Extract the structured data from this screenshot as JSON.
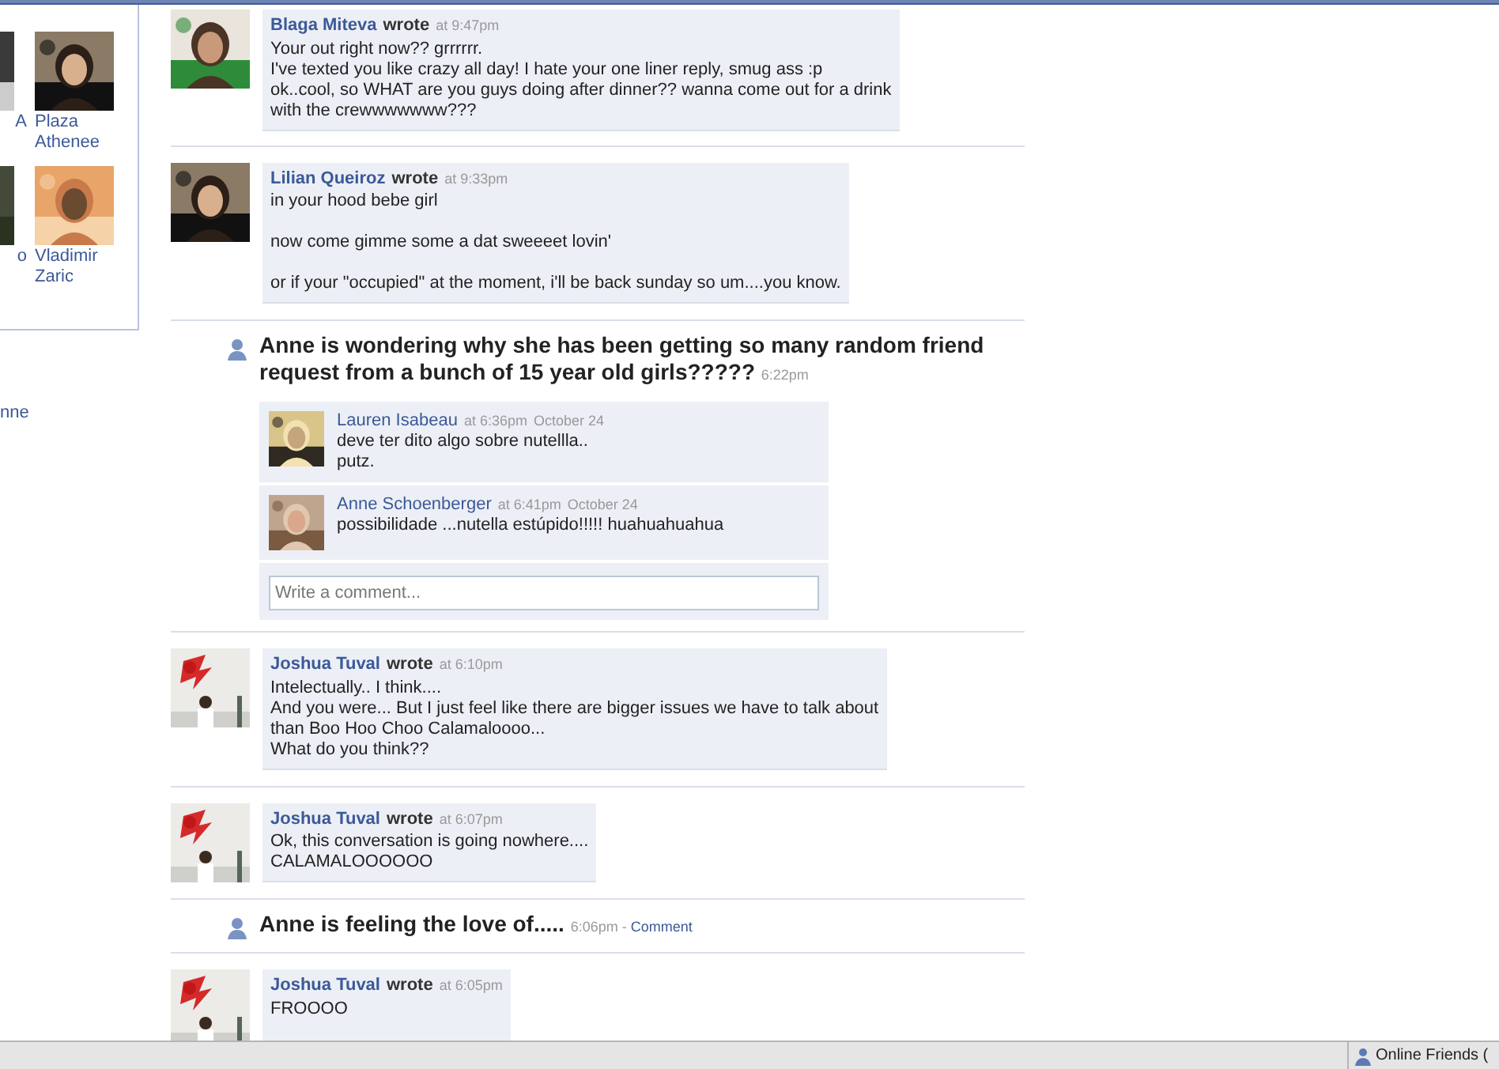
{
  "sidebar": {
    "friends": [
      {
        "name": "A"
      },
      {
        "name": "Plaza Athenee"
      },
      {
        "name": "o"
      },
      {
        "name": "Vladimir Zaric"
      }
    ],
    "link": "nne"
  },
  "feed": [
    {
      "kind": "wall_post",
      "author": "Blaga Miteva",
      "verb": "wrote",
      "time": "at 9:47pm",
      "paragraphs": [
        [
          "Your out right now?? grrrrrr.",
          "I've texted you like crazy all day! I hate your one liner reply, smug ass :p",
          "ok..cool, so WHAT are you guys doing after dinner?? wanna come out for a drink",
          "with the crewwwwwww???"
        ]
      ]
    },
    {
      "kind": "wall_post",
      "author": "Lilian Queiroz",
      "verb": "wrote",
      "time": "at 9:33pm",
      "paragraphs": [
        [
          "in your hood bebe girl"
        ],
        [
          "now come gimme some a dat sweeeet lovin'"
        ],
        [
          "or if your \"occupied\" at the moment, i'll be back sunday so um....you know."
        ]
      ]
    },
    {
      "kind": "status",
      "text": "Anne is wondering why she has been getting so many random friend request from a bunch of 15 year old girls?????",
      "time": "6:22pm",
      "comments": [
        {
          "author": "Lauren Isabeau",
          "time": "at 6:36pm",
          "date": "October 24",
          "lines": [
            "deve ter dito algo sobre nutellla..",
            "putz."
          ]
        },
        {
          "author": "Anne Schoenberger",
          "time": "at 6:41pm",
          "date": "October 24",
          "lines": [
            "possibilidade ...nutella estúpido!!!!! huahuahuahua"
          ]
        }
      ],
      "comment_placeholder": "Write a comment..."
    },
    {
      "kind": "wall_post",
      "author": "Joshua Tuval",
      "verb": "wrote",
      "time": "at 6:10pm",
      "paragraphs": [
        [
          "Intelectually.. I think....",
          "And you were... But I just feel like there are bigger issues we have to talk about",
          "than Boo Hoo Choo Calamaloooo...",
          "What do you think??"
        ]
      ]
    },
    {
      "kind": "wall_post",
      "author": "Joshua Tuval",
      "verb": "wrote",
      "time": "at 6:07pm",
      "paragraphs": [
        [
          "Ok, this conversation is going nowhere....",
          "CALAMALOOOOOO"
        ]
      ]
    },
    {
      "kind": "status",
      "text": "Anne is feeling the love of.....",
      "time": "6:06pm",
      "separator": "-",
      "link": "Comment"
    },
    {
      "kind": "wall_post",
      "author": "Joshua Tuval",
      "verb": "wrote",
      "time": "at 6:05pm",
      "paragraphs": [
        [
          "FROOOO"
        ]
      ]
    }
  ],
  "status_bar": {
    "online_friends": "Online Friends ("
  }
}
